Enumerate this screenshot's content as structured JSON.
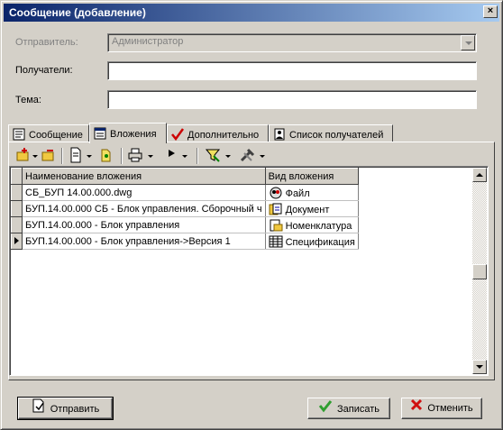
{
  "window": {
    "title": "Сообщение (добавление)",
    "close_glyph": "×"
  },
  "form": {
    "sender_label": "Отправитель:",
    "sender_value": "Администратор",
    "recipients_label": "Получатели:",
    "recipients_value": "",
    "subject_label": "Тема:",
    "subject_value": ""
  },
  "tabs": [
    {
      "label": "Сообщение",
      "icon": "message-icon"
    },
    {
      "label": "Вложения",
      "icon": "attachments-icon",
      "active": true
    },
    {
      "label": "Дополнительно",
      "icon": "checkmark-icon"
    },
    {
      "label": "Список получателей",
      "icon": "recipients-icon"
    }
  ],
  "toolbar": {
    "icons": [
      "add-attachment-icon",
      "remove-attachment-icon",
      "open-icon",
      "document-icon",
      "print-icon",
      "play-icon",
      "filter-icon",
      "tools-icon"
    ]
  },
  "grid": {
    "columns": [
      "Наименование вложения",
      "Вид вложения"
    ],
    "rows": [
      {
        "name": "СБ_БУП 14.00.000.dwg",
        "type": "Файл",
        "icon": "file-icon"
      },
      {
        "name": "БУП.14.00.000 СБ - Блок управления. Сборочный ч",
        "type": "Документ",
        "icon": "document-icon"
      },
      {
        "name": "БУП.14.00.000 - Блок управления",
        "type": "Номенклатура",
        "icon": "nomenclature-icon"
      },
      {
        "name": "БУП.14.00.000 - Блок управления->Версия 1",
        "type": "Спецификация",
        "icon": "specification-icon",
        "current": true
      }
    ]
  },
  "buttons": {
    "send": "Отправить",
    "save": "Записать",
    "cancel": "Отменить"
  },
  "colors": {
    "titlebar_start": "#0a246a",
    "titlebar_end": "#a6caf0",
    "face": "#d4d0c8",
    "ok_green": "#2f9e2f",
    "cancel_red": "#d01010"
  }
}
